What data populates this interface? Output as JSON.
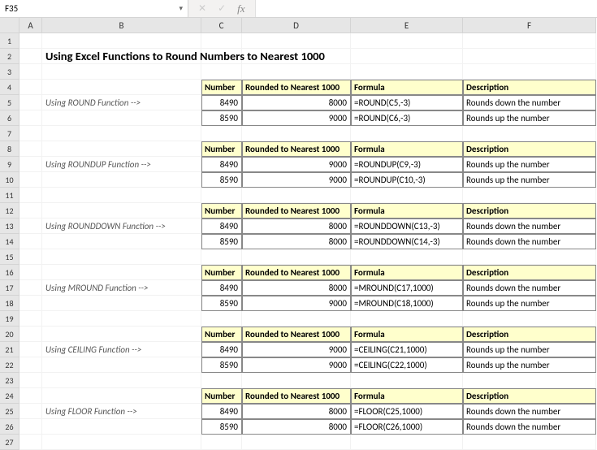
{
  "namebox": {
    "value": "F35",
    "caret": "▾"
  },
  "fb": {
    "x": "✕",
    "v": "✓",
    "fx": "fx",
    "content": ""
  },
  "colHeaders": [
    "A",
    "B",
    "C",
    "D",
    "E",
    "F"
  ],
  "rowNums": [
    "1",
    "2",
    "3",
    "4",
    "5",
    "6",
    "7",
    "8",
    "9",
    "10",
    "11",
    "12",
    "13",
    "14",
    "15",
    "16",
    "17",
    "18",
    "19",
    "20",
    "21",
    "22",
    "23",
    "24",
    "25",
    "26",
    "27"
  ],
  "title": "Using Excel Functions to Round Numbers to Nearest 1000",
  "headers": {
    "c": "Number",
    "d": "Rounded to Nearest 1000",
    "e": "Formula",
    "f": "Description"
  },
  "sections": [
    {
      "label": "Using ROUND Function -->",
      "rows": [
        {
          "n": "8490",
          "r": "8000",
          "f": "=ROUND(C5,-3)",
          "d": "Rounds down the number"
        },
        {
          "n": "8590",
          "r": "9000",
          "f": "=ROUND(C6,-3)",
          "d": "Rounds up the number"
        }
      ]
    },
    {
      "label": "Using ROUNDUP Function -->",
      "rows": [
        {
          "n": "8490",
          "r": "9000",
          "f": "=ROUNDUP(C9,-3)",
          "d": "Rounds up the number"
        },
        {
          "n": "8590",
          "r": "9000",
          "f": "=ROUNDUP(C10,-3)",
          "d": "Rounds up the number"
        }
      ]
    },
    {
      "label": "Using ROUNDDOWN Function -->",
      "rows": [
        {
          "n": "8490",
          "r": "8000",
          "f": "=ROUNDDOWN(C13,-3)",
          "d": "Rounds down the number"
        },
        {
          "n": "8590",
          "r": "8000",
          "f": "=ROUNDDOWN(C14,-3)",
          "d": "Rounds down the number"
        }
      ]
    },
    {
      "label": "Using MROUND Function -->",
      "rows": [
        {
          "n": "8490",
          "r": "8000",
          "f": "=MROUND(C17,1000)",
          "d": "Rounds down the number"
        },
        {
          "n": "8590",
          "r": "9000",
          "f": "=MROUND(C18,1000)",
          "d": "Rounds up the number"
        }
      ]
    },
    {
      "label": "Using CEILING Function -->",
      "rows": [
        {
          "n": "8490",
          "r": "9000",
          "f": "=CEILING(C21,1000)",
          "d": "Rounds up the number"
        },
        {
          "n": "8590",
          "r": "9000",
          "f": "=CEILING(C22,1000)",
          "d": "Rounds up the number"
        }
      ]
    },
    {
      "label": "Using FLOOR Function -->",
      "rows": [
        {
          "n": "8490",
          "r": "8000",
          "f": "=FLOOR(C25,1000)",
          "d": "Rounds down the number"
        },
        {
          "n": "8590",
          "r": "8000",
          "f": "=FLOOR(C26,1000)",
          "d": "Rounds down the number"
        }
      ]
    }
  ]
}
